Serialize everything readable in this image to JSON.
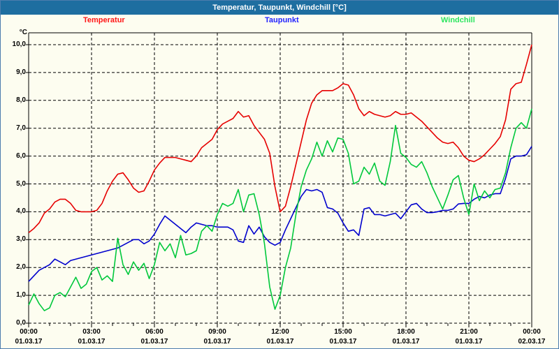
{
  "window": {
    "title": "Temperatur, Taupunkt, Windchill [°C]"
  },
  "colors": {
    "titlebar_bg": "#1e6ea0",
    "titlebar_text": "#ffffff",
    "window_bg": "#fdfdf0",
    "window_border": "#4c7cad",
    "axis": "#000000",
    "temperatur_line": "#e60000",
    "taupunkt_line": "#0000cd",
    "windchill_line": "#00c83c",
    "temperatur_label": "#ff1515",
    "taupunkt_label": "#2222ff",
    "windchill_label": "#2ce65f"
  },
  "legend": {
    "items": [
      {
        "label": "Temperatur",
        "color_key": "temperatur_label"
      },
      {
        "label": "Taupunkt",
        "color_key": "taupunkt_label"
      },
      {
        "label": "Windchill",
        "color_key": "windchill_label"
      }
    ]
  },
  "chart_data": {
    "type": "line",
    "title": "Temperatur, Taupunkt, Windchill [°C]",
    "ylabel": "°C",
    "xlabel": "",
    "ylim": [
      0,
      10.43
    ],
    "xlim_hours": [
      0,
      24
    ],
    "grid": "dashed",
    "legend_position": "top",
    "y_tick_labels": [
      "0,0",
      "1,0",
      "2,0",
      "3,0",
      "4,0",
      "5,0",
      "6,0",
      "7,0",
      "8,0",
      "9,0",
      "10,0"
    ],
    "x_ticks": [
      {
        "time": "00:00",
        "date": "01.03.17"
      },
      {
        "time": "03:00",
        "date": "01.03.17"
      },
      {
        "time": "06:00",
        "date": "01.03.17"
      },
      {
        "time": "09:00",
        "date": "01.03.17"
      },
      {
        "time": "12:00",
        "date": "01.03.17"
      },
      {
        "time": "15:00",
        "date": "01.03.17"
      },
      {
        "time": "18:00",
        "date": "01.03.17"
      },
      {
        "time": "21:00",
        "date": "01.03.17"
      },
      {
        "time": "00:00",
        "date": "02.03.17"
      }
    ],
    "x_major_step_hours": 3,
    "x_minor_step_hours": 1,
    "x_start_hours": 0,
    "x_step_hours": 0.25,
    "series": [
      {
        "name": "Temperatur",
        "color": "#e60000",
        "values": [
          3.25,
          3.4,
          3.6,
          3.95,
          4.1,
          4.35,
          4.45,
          4.45,
          4.3,
          4.05,
          4.0,
          4.0,
          4.0,
          4.05,
          4.3,
          4.75,
          5.1,
          5.35,
          5.4,
          5.15,
          4.85,
          4.7,
          4.75,
          5.1,
          5.5,
          5.75,
          5.95,
          5.95,
          5.95,
          5.9,
          5.85,
          5.8,
          6.0,
          6.3,
          6.45,
          6.6,
          6.95,
          7.15,
          7.25,
          7.35,
          7.6,
          7.4,
          7.45,
          7.1,
          6.85,
          6.6,
          6.1,
          4.9,
          4.0,
          4.2,
          4.9,
          5.7,
          6.5,
          7.3,
          7.9,
          8.2,
          8.35,
          8.35,
          8.35,
          8.45,
          8.6,
          8.55,
          8.2,
          7.7,
          7.45,
          7.6,
          7.5,
          7.45,
          7.4,
          7.45,
          7.6,
          7.5,
          7.5,
          7.55,
          7.4,
          7.25,
          7.05,
          6.85,
          6.65,
          6.5,
          6.45,
          6.5,
          6.3,
          6.0,
          5.85,
          5.8,
          5.9,
          6.05,
          6.25,
          6.45,
          6.7,
          7.3,
          8.4,
          8.6,
          8.65,
          9.3,
          10.0
        ]
      },
      {
        "name": "Taupunkt",
        "color": "#0000cd",
        "values": [
          1.5,
          1.7,
          1.9,
          2.0,
          2.1,
          2.3,
          2.2,
          2.1,
          2.25,
          2.3,
          2.35,
          2.4,
          2.45,
          2.5,
          2.55,
          2.6,
          2.65,
          2.7,
          2.8,
          2.9,
          3.0,
          3.0,
          2.85,
          2.95,
          3.2,
          3.55,
          3.85,
          3.7,
          3.55,
          3.4,
          3.25,
          3.45,
          3.6,
          3.55,
          3.5,
          3.5,
          3.45,
          3.45,
          3.45,
          3.35,
          2.95,
          2.9,
          3.5,
          3.2,
          3.45,
          3.1,
          2.9,
          2.8,
          2.9,
          3.35,
          3.75,
          4.15,
          4.55,
          4.8,
          4.75,
          4.8,
          4.7,
          4.15,
          4.1,
          3.95,
          3.6,
          3.3,
          3.35,
          3.15,
          4.1,
          4.15,
          3.9,
          3.9,
          3.85,
          3.9,
          3.95,
          3.75,
          4.0,
          4.25,
          4.3,
          4.1,
          3.97,
          3.97,
          4.0,
          4.05,
          4.05,
          4.1,
          4.28,
          4.3,
          4.3,
          4.45,
          4.55,
          4.5,
          4.6,
          4.65,
          4.65,
          5.2,
          5.9,
          6.0,
          6.0,
          6.05,
          6.35
        ]
      },
      {
        "name": "Windchill",
        "color": "#00c83c",
        "values": [
          0.65,
          1.05,
          0.7,
          0.45,
          0.55,
          1.0,
          1.1,
          0.95,
          1.3,
          1.65,
          1.25,
          1.4,
          1.85,
          2.0,
          1.55,
          1.7,
          1.5,
          3.05,
          2.1,
          1.75,
          2.2,
          1.9,
          2.15,
          1.6,
          2.1,
          2.9,
          2.6,
          2.85,
          2.35,
          3.15,
          2.45,
          2.5,
          2.6,
          3.3,
          3.5,
          3.3,
          3.9,
          4.3,
          4.2,
          4.3,
          4.8,
          4.0,
          4.6,
          4.65,
          3.9,
          2.85,
          1.3,
          0.5,
          1.0,
          2.0,
          2.7,
          3.9,
          4.9,
          5.5,
          5.9,
          6.5,
          6.0,
          6.55,
          6.15,
          6.65,
          6.6,
          6.1,
          5.0,
          5.1,
          5.6,
          5.35,
          5.75,
          5.1,
          4.95,
          5.8,
          7.1,
          6.1,
          5.95,
          5.7,
          5.6,
          5.8,
          5.4,
          4.9,
          4.5,
          4.1,
          4.6,
          5.15,
          5.3,
          4.5,
          3.9,
          5.0,
          4.4,
          4.75,
          4.5,
          4.8,
          4.85,
          5.4,
          6.3,
          7.0,
          7.2,
          7.0,
          7.7
        ]
      }
    ]
  }
}
